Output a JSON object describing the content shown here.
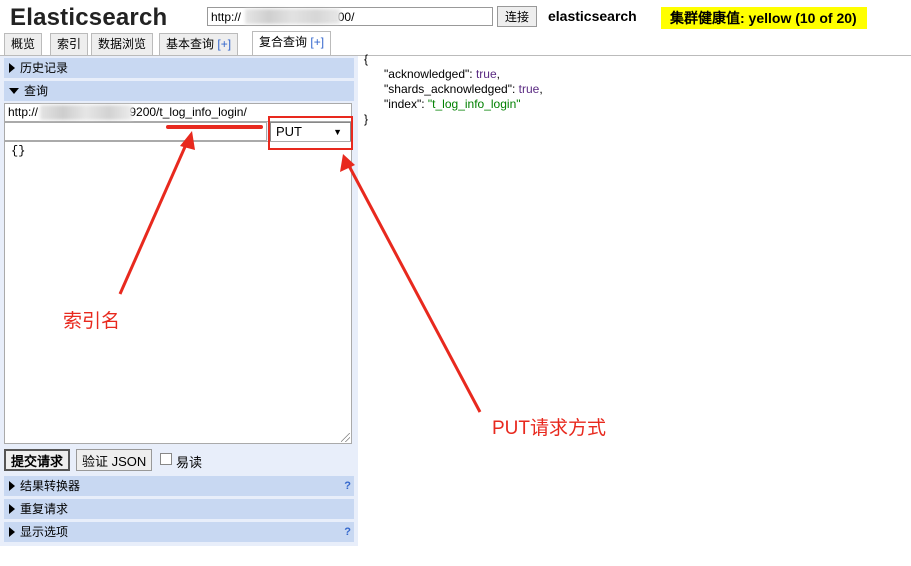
{
  "header": {
    "logo": "Elasticsearch",
    "url_value": "http://                         9200/",
    "connect_label": "连接",
    "cluster_name": "elasticsearch",
    "health_text": "集群健康值: yellow (10 of 20)"
  },
  "tabs": [
    {
      "label": "概览",
      "plus": ""
    },
    {
      "label": "索引",
      "plus": ""
    },
    {
      "label": "数据浏览",
      "plus": ""
    },
    {
      "label": "基本查询",
      "plus": "[+]"
    },
    {
      "label": "复合查询",
      "plus": "[+]"
    }
  ],
  "left": {
    "history_label": "历史记录",
    "query_label": "查询",
    "query_url_prefix": "http://",
    "query_url_suffix": ":9200/t_log_info_login/",
    "method": "PUT",
    "body": "{}",
    "submit_label": "提交请求",
    "validate_label": "验证 JSON",
    "readable_label": "易读",
    "transformer_label": "结果转换器",
    "repeat_label": "重复请求",
    "display_options_label": "显示选项",
    "help_mark": "?"
  },
  "result": {
    "open": "{",
    "acknowledged_key": "\"acknowledged\"",
    "acknowledged_val": "true",
    "shards_key": "\"shards_acknowledged\"",
    "shards_val": "true",
    "index_key": "\"index\"",
    "index_val": "\"t_log_info_login\"",
    "close": "}"
  },
  "annotations": {
    "index_name_label": "索引名",
    "put_label": "PUT请求方式",
    "color": "#e8291e"
  }
}
